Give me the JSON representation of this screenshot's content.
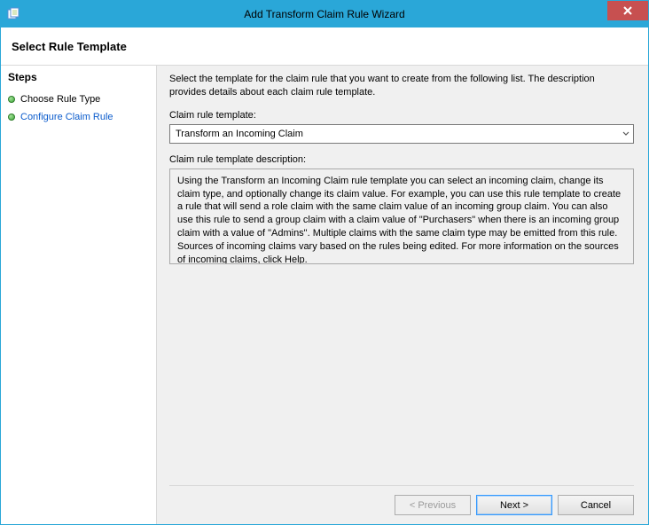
{
  "window": {
    "title": "Add Transform Claim Rule Wizard"
  },
  "header": {
    "page_title": "Select Rule Template"
  },
  "sidebar": {
    "label": "Steps",
    "items": [
      {
        "label": "Choose Rule Type"
      },
      {
        "label": "Configure Claim Rule"
      }
    ]
  },
  "main": {
    "instruction": "Select the template for the claim rule that you want to create from the following list. The description provides details about each claim rule template.",
    "template_label": "Claim rule template:",
    "template_selected": "Transform an Incoming Claim",
    "description_label": "Claim rule template description:",
    "description_text": "Using the Transform an Incoming Claim rule template you can select an incoming claim, change its claim type, and optionally change its claim value.  For example, you can use this rule template to create a rule that will send a role claim with the same claim value of an incoming group claim.  You can also use this rule to send a group claim with a claim value of \"Purchasers\" when there is an incoming group claim with a value of \"Admins\".  Multiple claims with the same claim type may be emitted from this rule.  Sources of incoming claims vary based on the rules being edited.  For more information on the sources of incoming claims, click Help."
  },
  "footer": {
    "previous": "< Previous",
    "next": "Next >",
    "cancel": "Cancel"
  }
}
